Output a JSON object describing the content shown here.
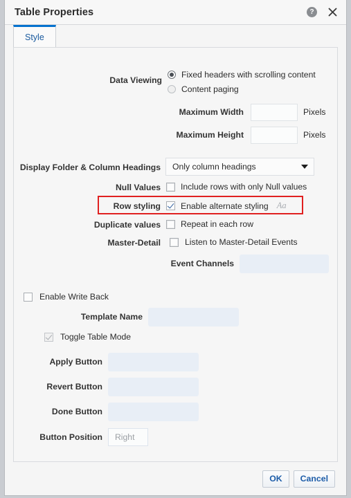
{
  "window": {
    "title": "Table Properties",
    "help_icon": "help-icon",
    "close_icon": "close-icon"
  },
  "tabs": [
    {
      "label": "Style",
      "selected": true
    }
  ],
  "form": {
    "data_viewing": {
      "label": "Data Viewing",
      "options": [
        {
          "label": "Fixed headers with scrolling content",
          "selected": true
        },
        {
          "label": "Content paging",
          "selected": false
        }
      ]
    },
    "maximum_width": {
      "label": "Maximum Width",
      "value": "",
      "unit": "Pixels"
    },
    "maximum_height": {
      "label": "Maximum Height",
      "value": "",
      "unit": "Pixels"
    },
    "display_headings": {
      "label": "Display Folder & Column Headings",
      "value": "Only column headings",
      "options": [
        "Only column headings"
      ]
    },
    "null_values": {
      "label": "Null Values",
      "checkbox_label": "Include rows with only Null values",
      "checked": false
    },
    "row_styling": {
      "label": "Row styling",
      "checkbox_label": "Enable alternate styling",
      "checked": true,
      "font_icon": "Aa",
      "highlight_color": "#e02020"
    },
    "duplicate_values": {
      "label": "Duplicate values",
      "checkbox_label": "Repeat in each row",
      "checked": false
    },
    "master_detail": {
      "label": "Master-Detail",
      "checkbox_label": "Listen to Master-Detail Events",
      "checked": false
    },
    "event_channels": {
      "label": "Event Channels",
      "value": ""
    },
    "enable_write_back": {
      "label": "Enable Write Back",
      "checked": false
    },
    "template_name": {
      "label": "Template Name",
      "value": ""
    },
    "toggle_table_mode": {
      "label": "Toggle Table Mode",
      "checked": true,
      "disabled": true
    },
    "apply_button": {
      "label": "Apply Button",
      "value": ""
    },
    "revert_button": {
      "label": "Revert Button",
      "value": ""
    },
    "done_button": {
      "label": "Done Button",
      "value": ""
    },
    "button_position": {
      "label": "Button Position",
      "value": "Right"
    }
  },
  "footer": {
    "ok_label": "OK",
    "cancel_label": "Cancel"
  }
}
